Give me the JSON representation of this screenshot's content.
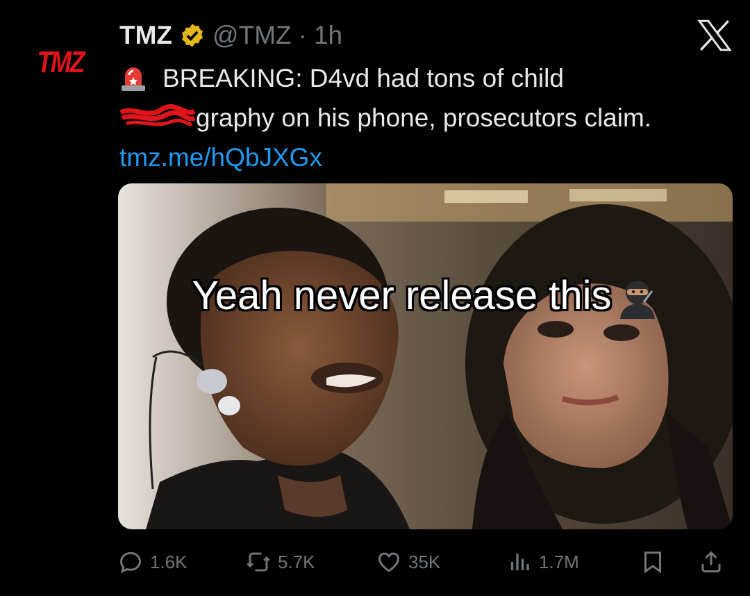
{
  "avatar": {
    "logo_text": "TMZ"
  },
  "header": {
    "name": "TMZ",
    "verified": "verified-badge-icon",
    "handle": "@TMZ",
    "separator": "·",
    "time": "1h"
  },
  "tweet": {
    "line1": "BREAKING: D4vd had tons of child",
    "line2": "graphy on his phone, prosecutors claim.",
    "link": "tmz.me/hQbJXGx"
  },
  "media": {
    "caption": "Yeah never release this"
  },
  "actions": {
    "replies": "1.6K",
    "reposts": "5.7K",
    "likes": "35K",
    "views": "1.7M"
  },
  "colors": {
    "background": "#000000",
    "text": "#e7e9ea",
    "muted": "#71767b",
    "link": "#1d9bf0",
    "brand_red": "#e0141b",
    "verified_gold": "#e2b719"
  }
}
